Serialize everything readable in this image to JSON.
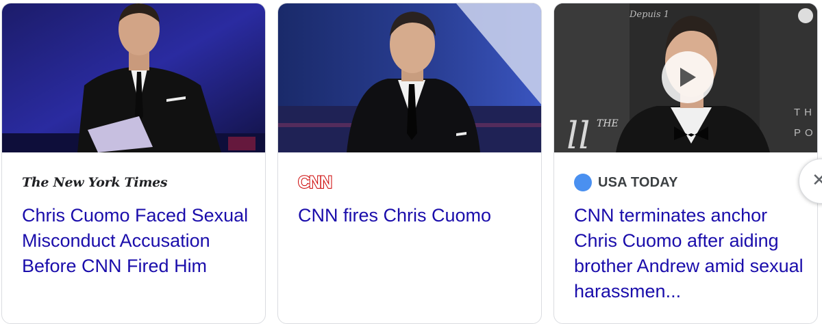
{
  "cards": [
    {
      "source": "The New York Times",
      "headline": "Chris Cuomo Faced Sexual Misconduct Accusation Before CNN Fired Him"
    },
    {
      "source": "CNN",
      "headline": "CNN fires Chris Cuomo"
    },
    {
      "source": "USA TODAY",
      "headline": "CNN terminates anchor Chris Cuomo after aiding brother Andrew amid sexual harassmen...",
      "has_video": true,
      "image_text": "TH PO"
    }
  ],
  "next_icon": "chevron-right-icon",
  "colors": {
    "headline": "#1a0dab",
    "border": "#dadce0",
    "cnn_red": "#cc0000",
    "usa_today_blue": "#4a90f0"
  }
}
